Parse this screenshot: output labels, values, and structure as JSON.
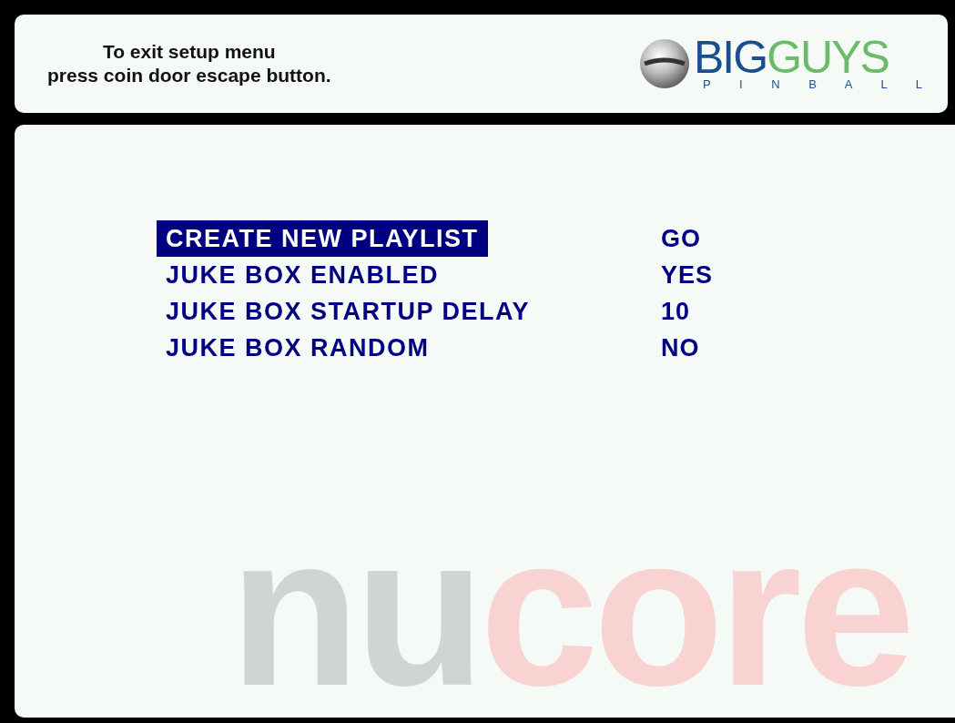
{
  "header": {
    "instructions": [
      "To exit setup menu",
      "press coin door escape button."
    ],
    "logo": {
      "word_1": "BIG",
      "word_2": "GUYS",
      "tagline": "P I N B A L L"
    }
  },
  "menu": [
    {
      "label": "CREATE NEW PLAYLIST",
      "value": "GO",
      "selected": true
    },
    {
      "label": "JUKE BOX ENABLED",
      "value": "YES",
      "selected": false
    },
    {
      "label": "JUKE BOX STARTUP DELAY",
      "value": "10",
      "selected": false
    },
    {
      "label": "JUKE BOX RANDOM",
      "value": "NO",
      "selected": false
    }
  ],
  "background_logo": {
    "part_1": "nu",
    "part_2": "core"
  }
}
